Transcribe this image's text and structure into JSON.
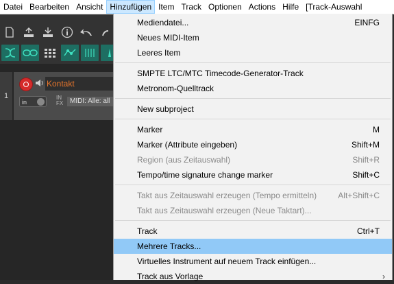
{
  "menubar": [
    "Datei",
    "Bearbeiten",
    "Ansicht",
    "Hinzufügen",
    "Item",
    "Track",
    "Optionen",
    "Actions",
    "Hilfe",
    "[Track-Auswahl"
  ],
  "track": {
    "number": "1",
    "name": "Kontakt",
    "input_label": "in",
    "infx_top": "IN",
    "infx_bottom": "FX",
    "midi_input": "MIDI: Alle: all"
  },
  "menu": {
    "items": [
      {
        "label": "Mediendatei...",
        "shortcut": "EINFG"
      },
      {
        "label": "Neues MIDI-Item",
        "shortcut": ""
      },
      {
        "label": "Leeres Item",
        "shortcut": ""
      },
      {
        "label": "SMPTE LTC/MTC Timecode-Generator-Track",
        "shortcut": ""
      },
      {
        "label": "Metronom-Quelltrack",
        "shortcut": ""
      },
      {
        "label": "New subproject",
        "shortcut": ""
      },
      {
        "label": "Marker",
        "shortcut": "M"
      },
      {
        "label": "Marker (Attribute eingeben)",
        "shortcut": "Shift+M"
      },
      {
        "label": "Region (aus Zeitauswahl)",
        "shortcut": "Shift+R"
      },
      {
        "label": "Tempo/time signature change marker",
        "shortcut": "Shift+C"
      },
      {
        "label": "Takt aus Zeitauswahl erzeugen (Tempo ermitteln)",
        "shortcut": "Alt+Shift+C"
      },
      {
        "label": "Takt aus Zeitauswahl erzeugen (Neue Taktart)...",
        "shortcut": ""
      },
      {
        "label": "Track",
        "shortcut": "Ctrl+T"
      },
      {
        "label": "Mehrere Tracks...",
        "shortcut": ""
      },
      {
        "label": "Virtuelles Instrument auf neuem Track einfügen...",
        "shortcut": ""
      },
      {
        "label": "Track aus Vorlage",
        "shortcut": ""
      }
    ]
  },
  "colors": {
    "accent_teal": "#1e6e62",
    "highlight": "#91c9f7",
    "track_name": "#e8762c",
    "record": "#d52a2a"
  }
}
